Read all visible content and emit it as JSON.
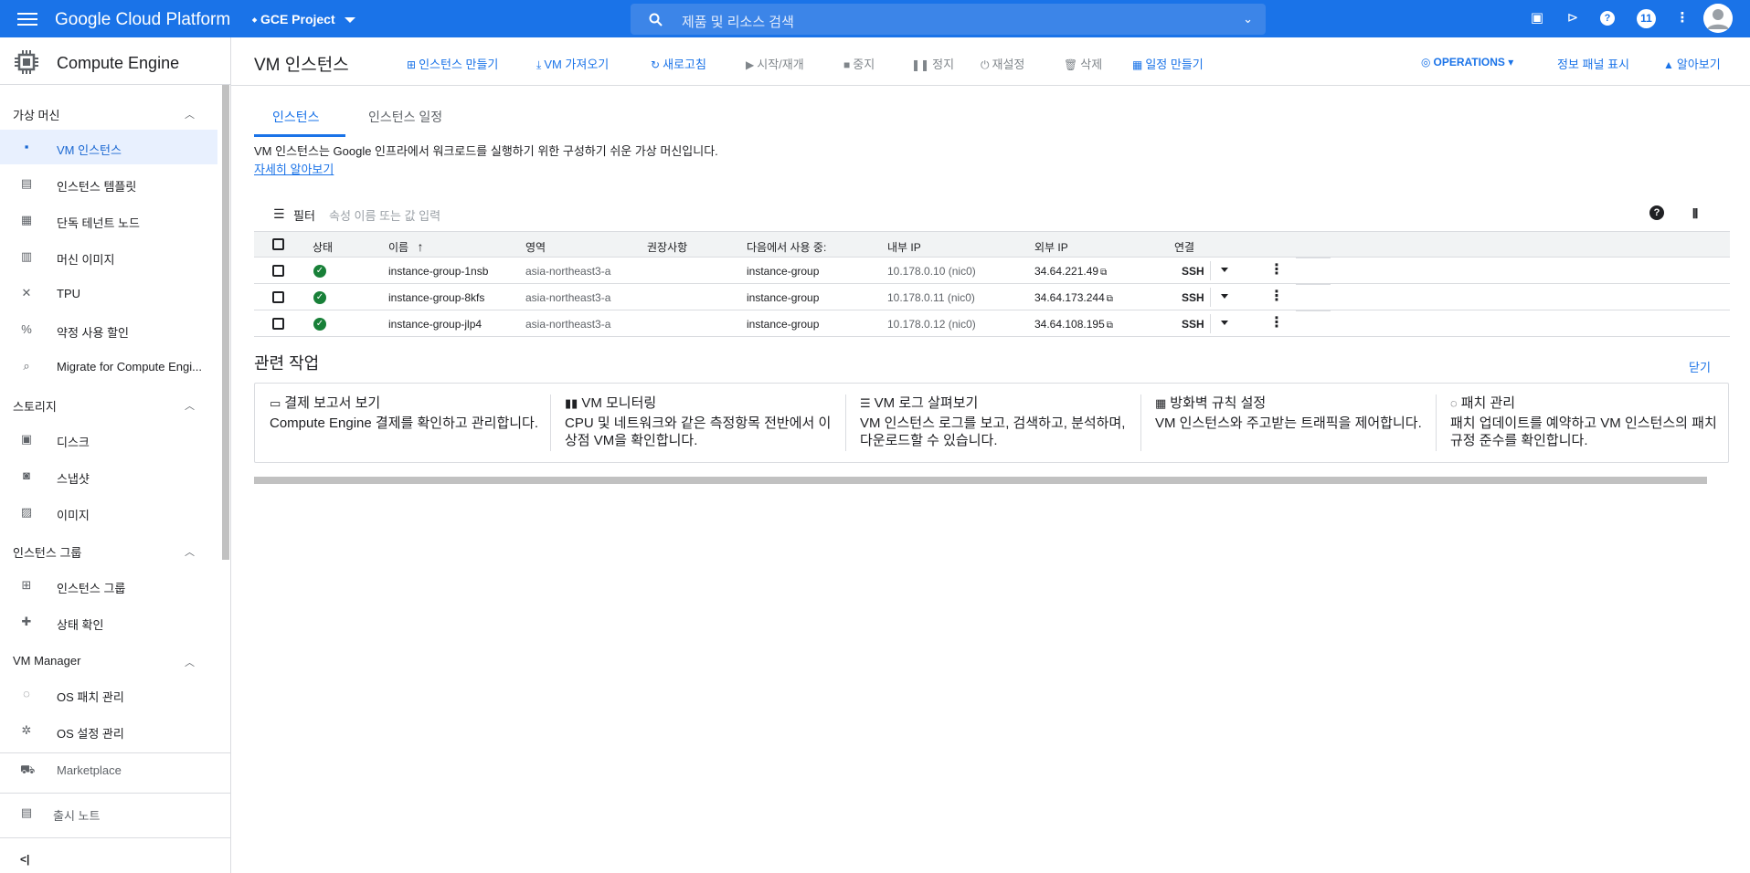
{
  "topbar": {
    "logo": "Google Cloud Platform",
    "project": "GCE Project",
    "search_placeholder": "제품 및 리소스 검색",
    "notifications": "11"
  },
  "sidebar": {
    "title": "Compute Engine",
    "sections": [
      {
        "label": "가상 머신",
        "items": [
          {
            "label": "VM 인스턴스",
            "icon": "vm-icon",
            "active": true
          },
          {
            "label": "인스턴스 템플릿",
            "icon": "template-icon"
          },
          {
            "label": "단독 테넌트 노드",
            "icon": "node-icon"
          },
          {
            "label": "머신 이미지",
            "icon": "machine-image-icon"
          },
          {
            "label": "TPU",
            "icon": "tpu-icon"
          },
          {
            "label": "약정 사용 할인",
            "icon": "discount-icon"
          },
          {
            "label": "Migrate for Compute Engi...",
            "icon": "search-icon"
          }
        ]
      },
      {
        "label": "스토리지",
        "items": [
          {
            "label": "디스크",
            "icon": "disk-icon"
          },
          {
            "label": "스냅샷",
            "icon": "snapshot-icon"
          },
          {
            "label": "이미지",
            "icon": "image-icon"
          }
        ]
      },
      {
        "label": "인스턴스 그룹",
        "items": [
          {
            "label": "인스턴스 그룹",
            "icon": "group-icon"
          },
          {
            "label": "상태 확인",
            "icon": "health-icon"
          }
        ]
      },
      {
        "label": "VM Manager",
        "items": [
          {
            "label": "OS 패치 관리",
            "icon": "patch-icon"
          },
          {
            "label": "OS 설정 관리",
            "icon": "settings-icon"
          }
        ]
      }
    ],
    "marketplace": "Marketplace",
    "release_notes": "출시 노트",
    "collapse": "<|"
  },
  "toolbar": {
    "title": "VM 인스턴스",
    "buttons": [
      {
        "label": "인스턴스 만들기",
        "icon": "add-box-icon",
        "enabled": true
      },
      {
        "label": "VM 가져오기",
        "icon": "download-icon",
        "enabled": true
      },
      {
        "label": "새로고침",
        "icon": "refresh-icon",
        "enabled": true
      },
      {
        "label": "시작/재개",
        "icon": "play-icon",
        "enabled": false
      },
      {
        "label": "중지",
        "icon": "stop-icon",
        "enabled": false
      },
      {
        "label": "정지",
        "icon": "pause-icon",
        "enabled": false
      },
      {
        "label": "재설정",
        "icon": "power-icon",
        "enabled": false
      },
      {
        "label": "삭제",
        "icon": "trash-icon",
        "enabled": false
      },
      {
        "label": "일정 만들기",
        "icon": "calendar-icon",
        "enabled": true
      }
    ],
    "operations": "OPERATIONS",
    "info_panel": "정보 패널 표시",
    "learn": "알아보기"
  },
  "tabs": [
    {
      "label": "인스턴스",
      "active": true
    },
    {
      "label": "인스턴스 일정",
      "active": false
    }
  ],
  "description": {
    "text": "VM 인스턴스는 Google 인프라에서 워크로드를 실행하기 위한 구성하기 쉬운 가상 머신입니다.",
    "link": "자세히 알아보기"
  },
  "filter": {
    "label": "필터",
    "placeholder": "속성 이름 또는 값 입력"
  },
  "table": {
    "columns": {
      "status": "상태",
      "name": "이름",
      "zone": "영역",
      "recommendation": "권장사항",
      "in_use_by": "다음에서 사용 중:",
      "internal_ip": "내부 IP",
      "external_ip": "외부 IP",
      "connect": "연결"
    },
    "rows": [
      {
        "name": "instance-group-1nsb",
        "zone": "asia-northeast3-a",
        "recommendation": "",
        "in_use_by": "instance-group",
        "internal_ip": "10.178.0.10",
        "nic": "(nic0)",
        "external_ip": "34.64.221.49",
        "connect": "SSH"
      },
      {
        "name": "instance-group-8kfs",
        "zone": "asia-northeast3-a",
        "recommendation": "",
        "in_use_by": "instance-group",
        "internal_ip": "10.178.0.11",
        "nic": "(nic0)",
        "external_ip": "34.64.173.244",
        "connect": "SSH"
      },
      {
        "name": "instance-group-jlp4",
        "zone": "asia-northeast3-a",
        "recommendation": "",
        "in_use_by": "instance-group",
        "internal_ip": "10.178.0.12",
        "nic": "(nic0)",
        "external_ip": "34.64.108.195",
        "connect": "SSH"
      }
    ]
  },
  "related": {
    "title": "관련 작업",
    "close": "닫기",
    "cards": [
      {
        "title": "결제 보고서 보기",
        "icon": "billing-icon",
        "desc": "Compute Engine 결제를 확인하고 관리합니다."
      },
      {
        "title": "VM 모니터링",
        "icon": "chart-icon",
        "desc": "CPU 및 네트워크와 같은 측정항목 전반에서 이상점 VM을 확인합니다."
      },
      {
        "title": "VM 로그 살펴보기",
        "icon": "logs-icon",
        "desc": "VM 인스턴스 로그를 보고, 검색하고, 분석하며, 다운로드할 수 있습니다."
      },
      {
        "title": "방화벽 규칙 설정",
        "icon": "firewall-icon",
        "desc": "VM 인스턴스와 주고받는 트래픽을 제어합니다."
      },
      {
        "title": "패치 관리",
        "icon": "patch-icon",
        "desc": "패치 업데이트를 예약하고 VM 인스턴스의 패치 규정 준수를 확인합니다."
      }
    ]
  },
  "colors": {
    "primary": "#1a73e8",
    "status_ok": "#188038",
    "active_bg": "#e8f0fe"
  }
}
